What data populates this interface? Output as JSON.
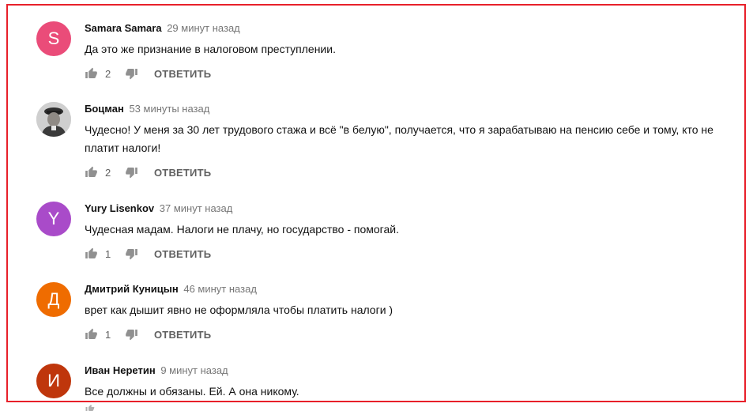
{
  "comments": [
    {
      "author": "Samara Samara",
      "time": "29 минут назад",
      "text": "Да это же признание в налоговом  преступлении.",
      "likes": "2",
      "reply": "ОТВЕТИТЬ",
      "avatar": {
        "letter": "S",
        "color": "#ea4c79"
      }
    },
    {
      "author": "Боцман",
      "time": "53 минуты назад",
      "text": "Чудесно! У меня за 30 лет трудового стажа и всё \"в белую\", получается, что я зарабатываю на пенсию себе и тому, кто не платит налоги!",
      "likes": "2",
      "reply": "ОТВЕТИТЬ",
      "avatar": {
        "letter": "",
        "color": "#b9b9b9",
        "kind": "photo"
      }
    },
    {
      "author": "Yury Lisenkov",
      "time": "37 минут назад",
      "text": "Чудесная мадам. Налоги не плачу, но государство - помогай.",
      "likes": "1",
      "reply": "ОТВЕТИТЬ",
      "avatar": {
        "letter": "Y",
        "color": "#a94bc9"
      }
    },
    {
      "author": "Дмитрий Куницын",
      "time": "46 минут назад",
      "text": "врет как дышит явно не оформляла чтобы платить налоги )",
      "likes": "1",
      "reply": "ОТВЕТИТЬ",
      "avatar": {
        "letter": "Д",
        "color": "#ef6c00"
      }
    },
    {
      "author": "Иван Неретин",
      "time": "9 минут назад",
      "text": "Все должны и обязаны. Ей. А она никому.",
      "likes": "",
      "reply": "",
      "avatar": {
        "letter": "И",
        "color": "#bf360c"
      }
    }
  ],
  "icons": {
    "like": "thumb-up-icon",
    "dislike": "thumb-down-icon"
  },
  "colors": {
    "highlight_border": "#e8202a",
    "meta_text": "#767676",
    "action_text": "#606060"
  }
}
